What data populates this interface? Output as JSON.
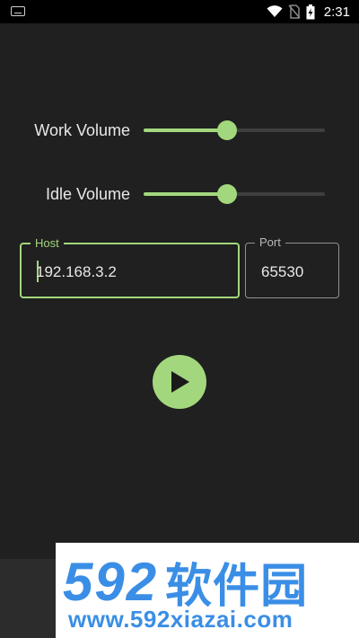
{
  "status_bar": {
    "time": "2:31",
    "icons": [
      "keyboard-icon",
      "wifi-icon",
      "no-sim-icon",
      "battery-charging-icon"
    ]
  },
  "controls": {
    "work_volume": {
      "label": "Work Volume",
      "value_fraction": 0.46
    },
    "idle_volume": {
      "label": "Idle Volume",
      "value_fraction": 0.46
    }
  },
  "fields": {
    "host": {
      "label": "Host",
      "value": "192.168.3.2"
    },
    "port": {
      "label": "Port",
      "value": "65530"
    }
  },
  "play_button": {
    "icon": "play-icon"
  },
  "watermark": {
    "brand_number": "592",
    "brand_text": "软件园",
    "url": "www.592xiazai.com"
  },
  "colors": {
    "accent": "#a3d77d",
    "background": "#1f201f",
    "watermark_blue": "#3a8ee6"
  }
}
